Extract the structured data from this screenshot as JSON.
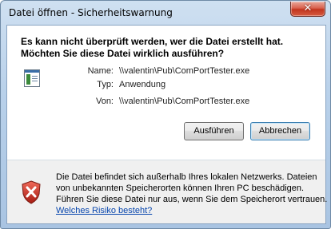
{
  "window": {
    "title": "Datei öffnen - Sicherheitswarnung"
  },
  "heading": {
    "line1": "Es kann nicht überprüft werden, wer die Datei erstellt hat.",
    "line2": "Möchten Sie diese Datei wirklich ausführen?"
  },
  "file_info": {
    "name_label": "Name:",
    "name_value": "\\\\valentin\\Pub\\ComPortTester.exe",
    "type_label": "Typ:",
    "type_value": "Anwendung",
    "from_label": "Von:",
    "from_value": "\\\\valentin\\Pub\\ComPortTester.exe"
  },
  "buttons": {
    "run": "Ausführen",
    "cancel": "Abbrechen"
  },
  "footer": {
    "line1": "Die Datei befindet sich außerhalb Ihres lokalen Netzwerks. Dateien",
    "line2": "von unbekannten Speicherorten können Ihren PC beschädigen.",
    "line3": "Führen Sie diese Datei nur aus, wenn Sie dem Speicherort vertrauen.",
    "link": "Welches Risiko besteht?"
  },
  "icons": {
    "close": "close-icon",
    "file": "file-icon",
    "warning": "warning-shield-icon"
  },
  "colors": {
    "accent": "#0645ad",
    "shield_red": "#c62828"
  }
}
